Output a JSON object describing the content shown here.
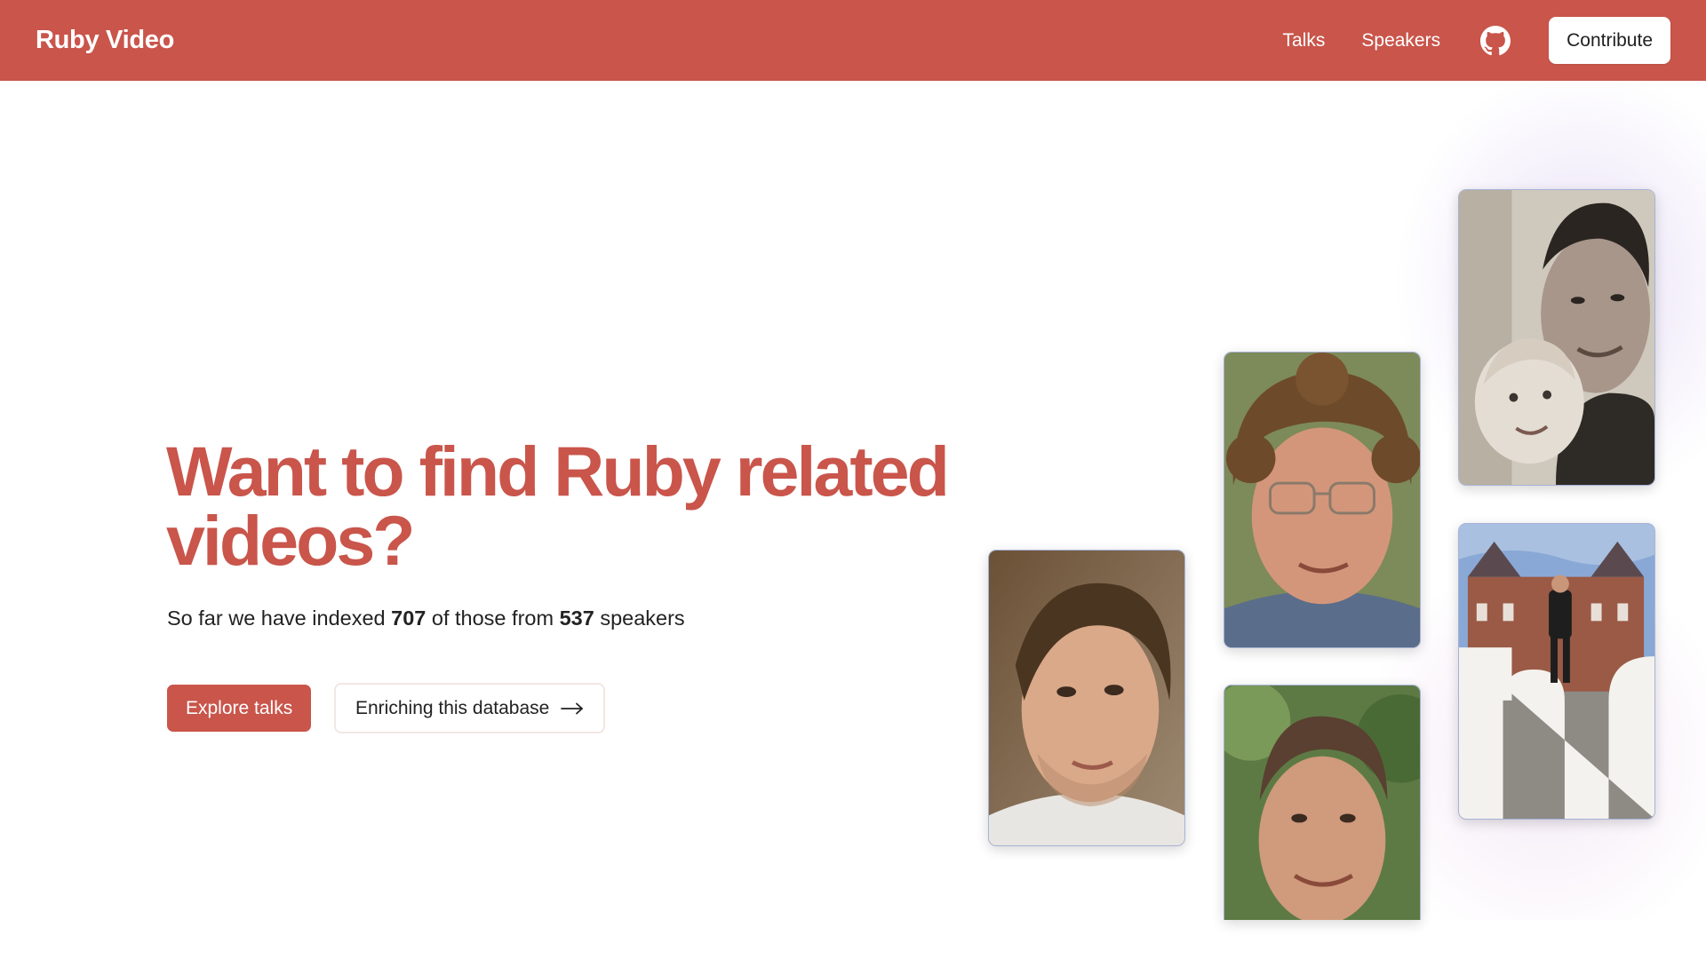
{
  "navbar": {
    "brand": "Ruby Video",
    "links": [
      "Talks",
      "Speakers"
    ],
    "contribute_label": "Contribute",
    "accent_color": "#c9554b"
  },
  "hero": {
    "title": "Want to find Ruby related videos?",
    "subtitle_prefix": "So far we have indexed",
    "talk_count": "707",
    "subtitle_middle": "of those from",
    "speaker_count": "537",
    "subtitle_suffix": "speakers",
    "primary_button": "Explore talks",
    "secondary_button": "Enriching this database"
  },
  "icons": {
    "github": "github-icon",
    "arrow": "arrow-right-icon"
  },
  "speaker_photos": [
    {
      "name": "speaker-photo-young-man"
    },
    {
      "name": "speaker-photo-curly-hair-glasses"
    },
    {
      "name": "speaker-photo-man-outdoors"
    },
    {
      "name": "speaker-photo-man-with-baby"
    },
    {
      "name": "speaker-photo-man-on-letter-sculpture"
    }
  ]
}
